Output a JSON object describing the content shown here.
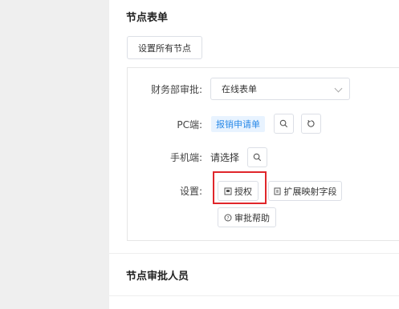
{
  "section1": {
    "title": "节点表单"
  },
  "toolbar": {
    "set_all_label": "设置所有节点"
  },
  "form": {
    "finance_label": "财务部审批:",
    "finance_value": "在线表单",
    "pc_label": "PC端:",
    "pc_tag": "报销申请单",
    "mobile_label": "手机端:",
    "mobile_value": "请选择",
    "settings_label": "设置:",
    "auth_label": "授权",
    "extend_label": "扩展映射字段",
    "help_label": "审批帮助"
  },
  "section2": {
    "title": "节点审批人员"
  },
  "colors": {
    "accent": "#2a8ae8",
    "highlight": "#e0262b"
  }
}
